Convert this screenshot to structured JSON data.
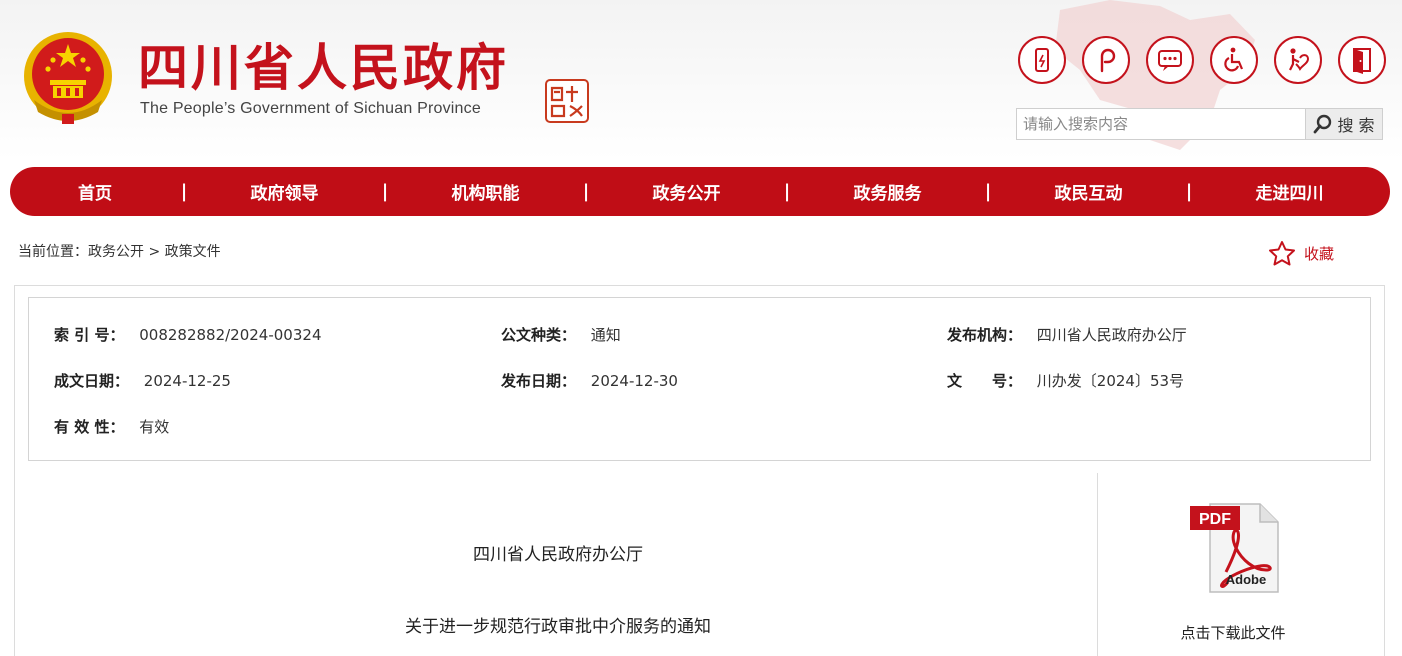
{
  "header": {
    "title": "四川省人民政府",
    "subtitle": "The People’s Government of Sichuan Province",
    "icons": [
      "mobile-icon",
      "weibo-icon",
      "message-icon",
      "accessibility-icon",
      "elderly-care-icon",
      "exit-icon"
    ],
    "search": {
      "placeholder": "请输入搜索内容",
      "button_label": "搜 索"
    }
  },
  "nav": [
    "首页",
    "政府领导",
    "机构职能",
    "政务公开",
    "政务服务",
    "政民互动",
    "走进四川"
  ],
  "nav_separator": "|",
  "breadcrumb": {
    "prefix": "当前位置：",
    "level1": "政务公开",
    "sep": ">",
    "level2": "政策文件"
  },
  "favorite_label": "收藏",
  "info": {
    "index_no": {
      "label": "索 引 号：",
      "value": "008282882/2024-00324"
    },
    "doc_type": {
      "label": "公文种类：",
      "value": "通知"
    },
    "publisher": {
      "label": "发布机构：",
      "value": "四川省人民政府办公厅"
    },
    "written_date": {
      "label": "成文日期：",
      "value": "2024-12-25"
    },
    "publish_date": {
      "label": "发布日期：",
      "value": "2024-12-30"
    },
    "doc_no": {
      "label": "文　　号：",
      "value": "川办发〔2024〕53号"
    },
    "validity": {
      "label": "有 效 性：",
      "value": "有效"
    }
  },
  "document": {
    "issuer": "四川省人民政府办公厅",
    "title": "关于进一步规范行政审批中介服务的通知"
  },
  "download": {
    "badge": "PDF",
    "brand": "Adobe",
    "label": "点击下载此文件"
  },
  "colors": {
    "brand_red": "#c00d16",
    "emblem_gold": "#f2c200"
  }
}
